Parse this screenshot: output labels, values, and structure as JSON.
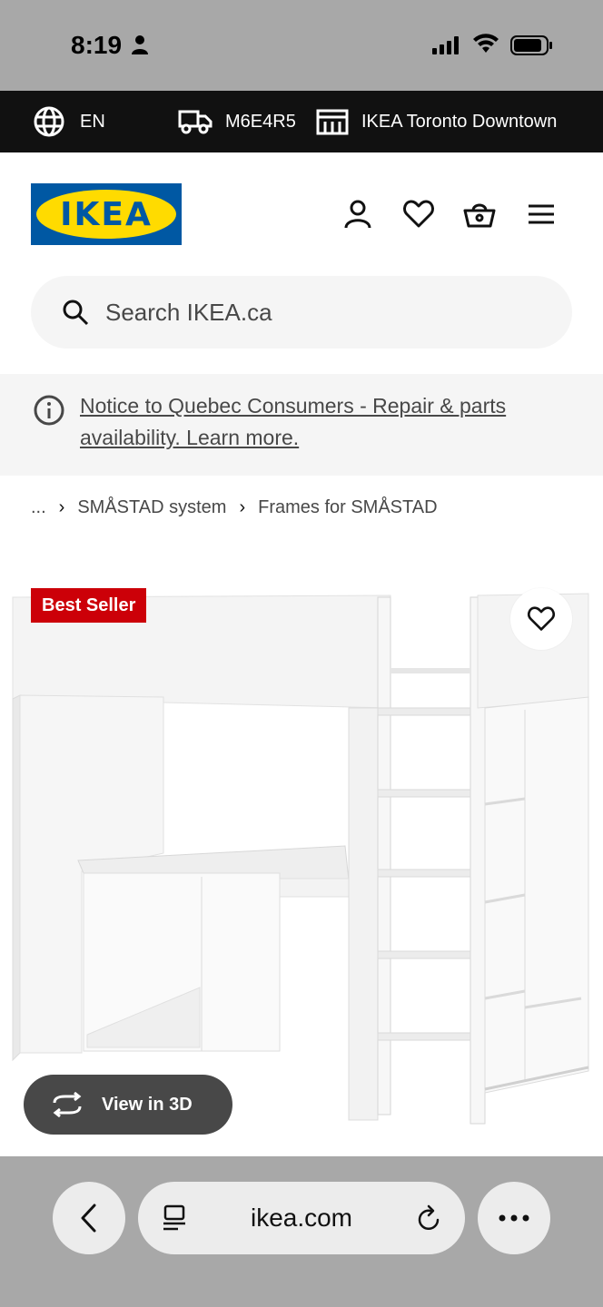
{
  "status_bar": {
    "time": "8:19"
  },
  "utility_bar": {
    "language": "EN",
    "postal_code": "M6E4R5",
    "store": "IKEA Toronto Downtown"
  },
  "header": {
    "logo_text": "IKEA",
    "icons": [
      "account-icon",
      "heart-icon",
      "cart-icon",
      "menu-icon"
    ]
  },
  "search": {
    "placeholder": "Search IKEA.ca"
  },
  "notice": {
    "text": "Notice to Quebec Consumers - Repair & parts availability. Learn more."
  },
  "breadcrumb": {
    "items": [
      "...",
      "SMÅSTAD system",
      "Frames for SMÅSTAD"
    ]
  },
  "product": {
    "badge": "Best Seller",
    "view_3d_label": "View in 3D"
  },
  "browser": {
    "url": "ikea.com"
  },
  "colors": {
    "ikea_blue": "#0058a3",
    "ikea_yellow": "#ffdb00",
    "badge_red": "#cc0008",
    "utility_bg": "#111111"
  }
}
